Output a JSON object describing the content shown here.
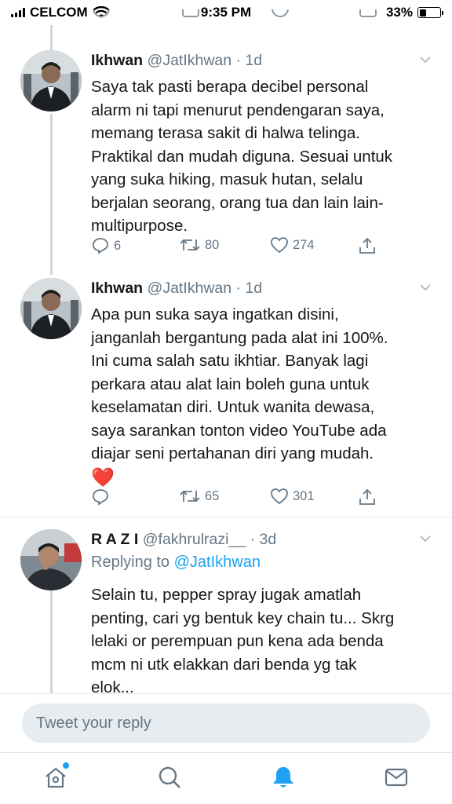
{
  "status_bar": {
    "carrier": "CELCOM",
    "time": "9:35 PM",
    "battery": "33%",
    "battery_level": 0.33
  },
  "tweets": [
    {
      "display_name": "Ikhwan",
      "handle": "@JatIkhwan",
      "age": "· 1d",
      "lines": [
        "Saya tak pasti berapa decibel personal",
        "alarm ni tapi menurut pendengaran saya,",
        "memang terasa sakit di halwa telinga.",
        "Praktikal dan mudah diguna. Sesuai untuk",
        "yang suka hiking, masuk hutan, selalu",
        "berjalan seorang, orang tua dan lain lain-",
        "multipurpose."
      ],
      "replies": "6",
      "retweets": "80",
      "likes": "274"
    },
    {
      "display_name": "Ikhwan",
      "handle": "@JatIkhwan",
      "age": "· 1d",
      "lines": [
        "Apa pun suka saya ingatkan disini,",
        "janganlah bergantung pada alat ini 100%.",
        "Ini cuma salah satu ikhtiar. Banyak lagi",
        "perkara atau alat lain boleh guna untuk",
        "keselamatan diri. Untuk wanita dewasa,",
        "saya sarankan tonton video YouTube ada",
        "diajar seni pertahanan diri yang mudah."
      ],
      "emoji": "❤️",
      "replies": "",
      "retweets": "65",
      "likes": "301"
    },
    {
      "display_name": "R A Z I",
      "handle": "@fakhrulrazi__",
      "age": "· 3d",
      "replying_label": "Replying to",
      "replying_handle": "@JatIkhwan",
      "lines": [
        "Selain tu, pepper spray jugak amatlah",
        "penting, cari yg bentuk key chain tu... Skrg",
        "lelaki or perempuan pun kena ada benda",
        "mcm ni utk elakkan dari benda yg tak",
        "elok..."
      ]
    }
  ],
  "reply_box": {
    "placeholder": "Tweet your reply"
  },
  "tab_bar": {
    "items": [
      "home-icon",
      "search-icon",
      "notifications-icon",
      "messages-icon"
    ],
    "active": "notifications-icon"
  },
  "colors": {
    "accent": "#1da1f2",
    "secondary_text": "#657786",
    "thread_line": "#ccd6dd",
    "heart": "#e0245e"
  }
}
